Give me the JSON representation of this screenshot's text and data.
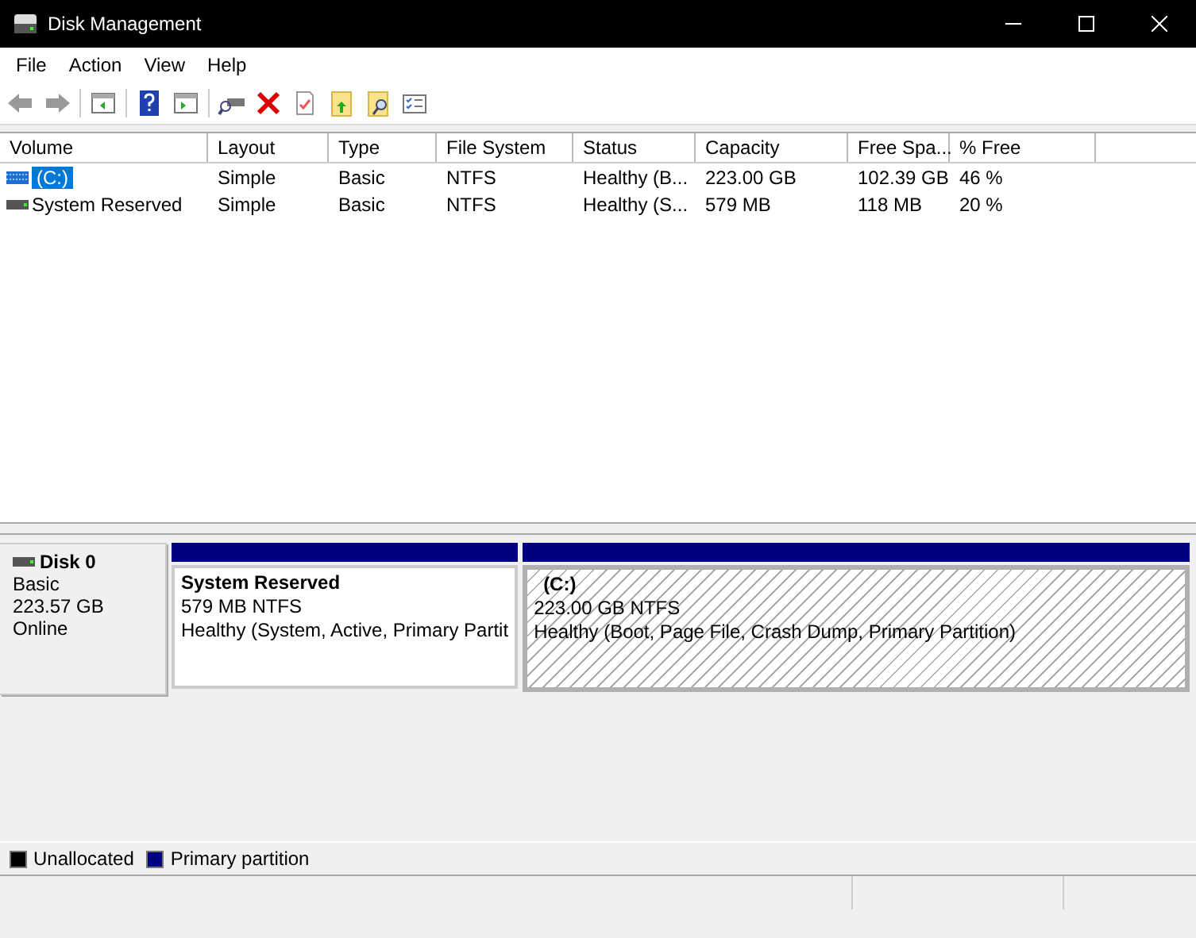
{
  "window": {
    "title": "Disk Management"
  },
  "menu": [
    "File",
    "Action",
    "View",
    "Help"
  ],
  "table": {
    "columns": [
      "Volume",
      "Layout",
      "Type",
      "File System",
      "Status",
      "Capacity",
      "Free Spa...",
      "% Free"
    ],
    "rows": [
      {
        "kind": "volume",
        "selected": true,
        "cells": [
          "(C:)",
          "Simple",
          "Basic",
          "NTFS",
          "Healthy (B...",
          "223.00 GB",
          "102.39 GB",
          "46 %"
        ]
      },
      {
        "kind": "reserved",
        "selected": false,
        "cells": [
          "System Reserved",
          "Simple",
          "Basic",
          "NTFS",
          "Healthy (S...",
          "579 MB",
          "118 MB",
          "20 %"
        ]
      }
    ]
  },
  "disks": [
    {
      "name": "Disk 0",
      "type": "Basic",
      "size": "223.57 GB",
      "state": "Online",
      "partitions": [
        {
          "name": "System Reserved",
          "size": "579 MB NTFS",
          "status": "Healthy (System, Active, Primary Partit",
          "selected": false,
          "color": "#000080"
        },
        {
          "name": "(C:)",
          "size": "223.00 GB NTFS",
          "status": "Healthy (Boot, Page File, Crash Dump, Primary Partition)",
          "selected": true,
          "color": "#000080"
        }
      ]
    }
  ],
  "legend": [
    {
      "label": "Unallocated",
      "color": "#000000"
    },
    {
      "label": "Primary partition",
      "color": "#000080"
    }
  ]
}
